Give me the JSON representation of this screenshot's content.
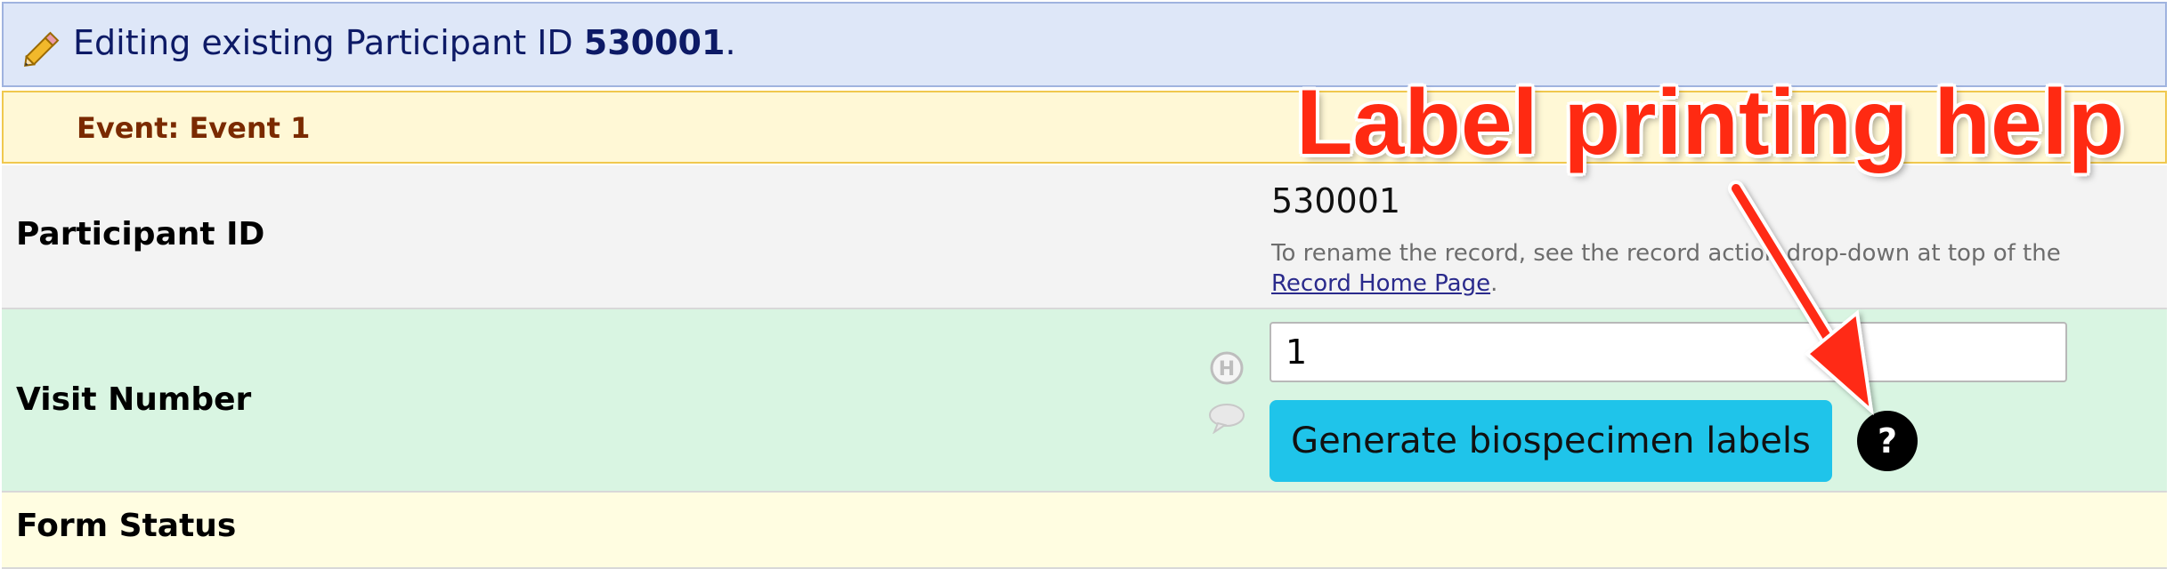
{
  "banner": {
    "prefix": "Editing existing Participant ID ",
    "record_id": "530001",
    "suffix": "."
  },
  "event": {
    "label": "Event: Event 1"
  },
  "participant": {
    "label": "Participant ID",
    "value": "530001",
    "note_prefix": "To rename the record, see the record action drop-down at top of the ",
    "note_link": "Record Home Page",
    "note_suffix": "."
  },
  "visit": {
    "label": "Visit Number",
    "value": "1",
    "button_label": "Generate biospecimen labels",
    "help_symbol": "?",
    "history_icon": "history-icon",
    "comment_icon": "comment-icon"
  },
  "form_status": {
    "label": "Form Status"
  },
  "annotation": {
    "text": "Label printing help",
    "color": "#ff2a12"
  },
  "colors": {
    "banner_bg": "#dee7f8",
    "event_bg": "#fff8d6",
    "visit_row_bg": "#d9f5e2",
    "button_bg": "#1fc4ea"
  }
}
